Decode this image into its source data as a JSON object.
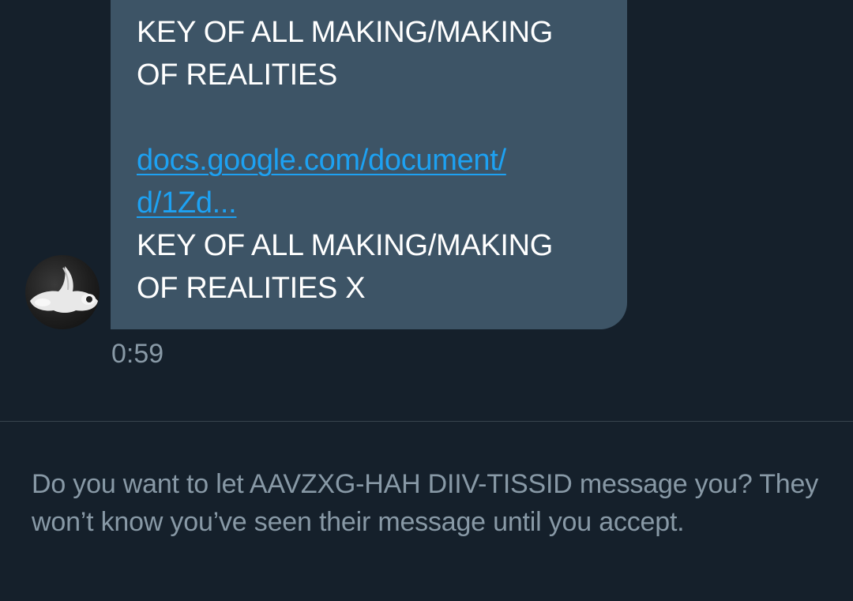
{
  "conversation": {
    "message": {
      "line1": "KEY OF ALL MAKING/MAKING",
      "line2": "OF REALITIES",
      "link_line1": "docs.google.com/document/",
      "link_line2": "d/1Zd...",
      "line3": "KEY OF ALL MAKING/MAKING",
      "line4": "OF REALITIES X",
      "timestamp": "0:59"
    },
    "avatar_icon": "bunny-mask-avatar"
  },
  "message_request": {
    "prompt": "Do you want to let AAVZXG-HAH DIIV-TISSID message you? They won’t know you’ve seen their message until you accept."
  },
  "colors": {
    "background": "#15202b",
    "bubble": "#3d5466",
    "link": "#1da1f2",
    "muted_text": "#8899a6"
  }
}
